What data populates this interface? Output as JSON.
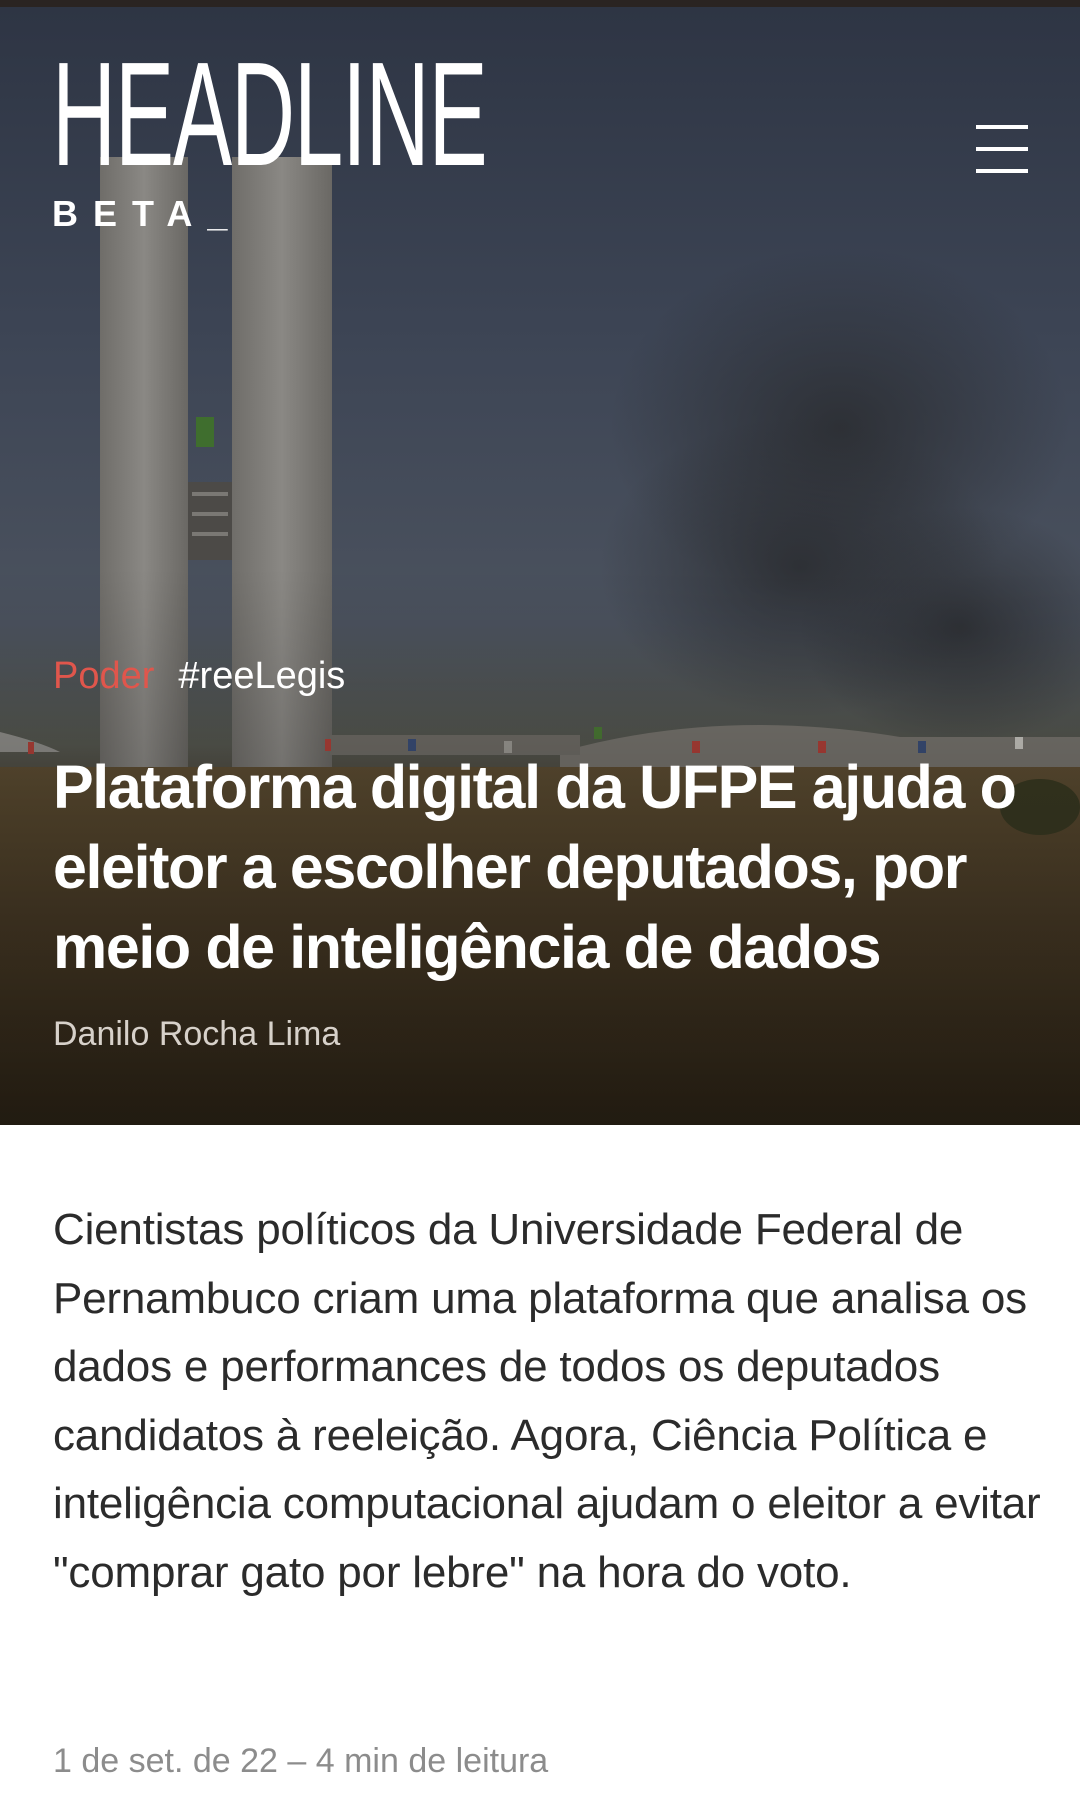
{
  "header": {
    "logo_word": "HEADLINE",
    "logo_sub": "BETA_",
    "menu_icon": "hamburger-menu-icon"
  },
  "article": {
    "section": "Poder",
    "hashtag": "#reeLegis",
    "title": "Plataforma digital da UFPE ajuda o eleitor a escolher deputados, por meio de inteligência de dados",
    "author": "Danilo Rocha Lima",
    "lead": "Cientistas políticos da Universidade Federal de Pernambuco criam uma plataforma que analisa os dados e performances de todos os deputados candidatos à reeleição. Agora, Ciência Política e inteligência computacional ajudam o eleitor a evitar \"comprar gato por lebre\" na hora do voto.",
    "meta": "1 de set. de 22 – 4 min de leitura"
  },
  "colors": {
    "section_accent": "#e0564c",
    "body_text": "#2b2b2b",
    "meta_text": "#8c8c8c"
  }
}
